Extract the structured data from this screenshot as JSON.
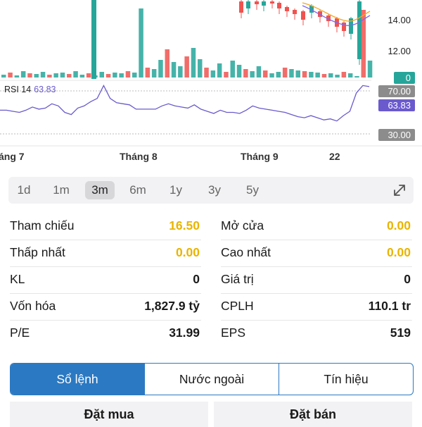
{
  "chart": {
    "price_ticks": [
      "14.00",
      "12.00"
    ],
    "volume_badge": "0",
    "rsi_label": "RSI 14",
    "rsi_value": "63.83",
    "rsi_badges": {
      "upper": "70.00",
      "current": "63.83",
      "lower": "30.00"
    },
    "x_labels": [
      "áng 7",
      "Tháng 8",
      "Tháng 9",
      "22"
    ],
    "colors": {
      "up": "#26a69a",
      "down": "#ef5350",
      "rsi": "#6a5acd",
      "ma_orange": "#f5a623",
      "ma_purple": "#7b68ee",
      "badge_green": "#26a69a",
      "badge_gray": "#8c8c8c"
    },
    "rsi_series": [
      52,
      52,
      51,
      50,
      52,
      55,
      53,
      54,
      58,
      56,
      50,
      48,
      54,
      56,
      60,
      63,
      75,
      63,
      59,
      58,
      57,
      53,
      53,
      53,
      53,
      56,
      58,
      56,
      55,
      54,
      57,
      53,
      51,
      49,
      52,
      50,
      50,
      49,
      52,
      56,
      54,
      53,
      52,
      51,
      50,
      48,
      46,
      45,
      47,
      45,
      43,
      44,
      42,
      47,
      51,
      68,
      75,
      74
    ]
  },
  "periods": [
    "1d",
    "1m",
    "3m",
    "6m",
    "1y",
    "3y",
    "5y"
  ],
  "active_period": "3m",
  "stats": {
    "left": [
      {
        "label": "Tham chiếu",
        "value": "16.50",
        "color": "yellow"
      },
      {
        "label": "Thấp nhất",
        "value": "0.00",
        "color": "yellow"
      },
      {
        "label": "KL",
        "value": "0",
        "color": "default"
      },
      {
        "label": "Vốn hóa",
        "value": "1,827.9 tỷ",
        "color": "default"
      },
      {
        "label": "P/E",
        "value": "31.99",
        "color": "default"
      }
    ],
    "right": [
      {
        "label": "Mở cửa",
        "value": "0.00",
        "color": "yellow"
      },
      {
        "label": "Cao nhất",
        "value": "0.00",
        "color": "yellow"
      },
      {
        "label": "Giá trị",
        "value": "0",
        "color": "default"
      },
      {
        "label": "CPLH",
        "value": "110.1 tr",
        "color": "default"
      },
      {
        "label": "EPS",
        "value": "519",
        "color": "default"
      }
    ]
  },
  "tabs": [
    "Sổ lệnh",
    "Nước ngoài",
    "Tín hiệu"
  ],
  "active_tab": "Sổ lệnh",
  "order": {
    "buy": "Đặt mua",
    "sell": "Đặt bán"
  }
}
